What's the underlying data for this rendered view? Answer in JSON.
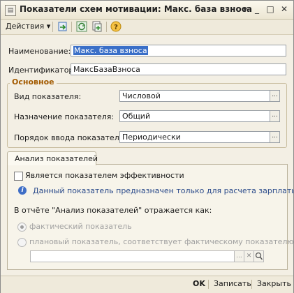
{
  "window": {
    "title": "Показатели схем мотивации: Макс. база взноса",
    "controls": {
      "dropdown": "▾",
      "minimize": "_",
      "maximize": "□",
      "close": "✕"
    }
  },
  "toolbar": {
    "actions_label": "Действия",
    "actions_arrow": "▾"
  },
  "form": {
    "name_label": "Наименование:",
    "name_value": "Макс. база взноса",
    "id_label": "Идентификатор:",
    "id_value": "МаксБазаВзноса"
  },
  "main_group": {
    "title": "Основное",
    "type_label": "Вид показателя:",
    "type_value": "Числовой",
    "purpose_label": "Назначение показателя:",
    "purpose_value": "Общий",
    "input_order_label": "Порядок ввода показателя:",
    "input_order_value": "Периодически"
  },
  "analysis_tab": {
    "tab_label": "Анализ показателей",
    "efficiency_checkbox_label": "Является показателем эффективности",
    "efficiency_checked": false,
    "info_text": "Данный показатель предназначен только для расчета зарплаты",
    "report_text": "В отчёте \"Анализ показателей\" отражается как:",
    "radio_actual": "фактический показатель",
    "radio_plan": "плановый показатель, соответствует фактическому показателю:",
    "selected": "radio_actual"
  },
  "bottom": {
    "ok": "OK",
    "save": "Записать",
    "close": "Закрыть"
  },
  "colors": {
    "group_title": "#a25a00",
    "selection": "#3a6fc8",
    "info": "#3f6ec6"
  }
}
